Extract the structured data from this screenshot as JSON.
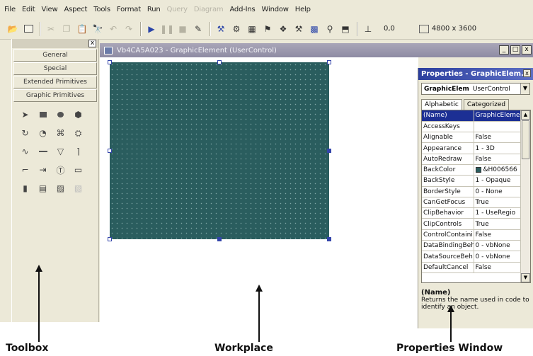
{
  "menu": [
    "File",
    "Edit",
    "View",
    "Aspect",
    "Tools",
    "Format",
    "Run",
    "Query",
    "Diagram",
    "Add-Ins",
    "Window",
    "Help"
  ],
  "menu_disabled": [
    "Query",
    "Diagram"
  ],
  "toolbar": {
    "coords": "0,0",
    "size": "4800 x 3600"
  },
  "toolbox": {
    "close_label": "x",
    "tabs": [
      "General",
      "Special",
      "Extended Primitives",
      "Graphic Primitives"
    ]
  },
  "document": {
    "title": "Vb4CA5A023 - GraphicElement (UserControl)",
    "controls": [
      "_",
      "□",
      "x"
    ],
    "canvas_color": "#2a5d5e"
  },
  "properties": {
    "title": "Properties - GraphicElem...",
    "close_label": "x",
    "object_name": "GraphicElem",
    "object_type": "UserControl",
    "tabs": [
      "Alphabetic",
      "Categorized"
    ],
    "rows": [
      {
        "name": "(Name)",
        "value": "GraphicEleme"
      },
      {
        "name": "AccessKeys",
        "value": ""
      },
      {
        "name": "Alignable",
        "value": "False"
      },
      {
        "name": "Appearance",
        "value": "1 - 3D"
      },
      {
        "name": "AutoRedraw",
        "value": "False"
      },
      {
        "name": "BackColor",
        "value": "&H006566"
      },
      {
        "name": "BackStyle",
        "value": "1 - Opaque"
      },
      {
        "name": "BorderStyle",
        "value": "0 - None"
      },
      {
        "name": "CanGetFocus",
        "value": "True"
      },
      {
        "name": "ClipBehavior",
        "value": "1 - UseRegio"
      },
      {
        "name": "ClipControls",
        "value": "True"
      },
      {
        "name": "ControlContaini",
        "value": "False"
      },
      {
        "name": "DataBindingBeh",
        "value": "0 - vbNone"
      },
      {
        "name": "DataSourceBeh",
        "value": "0 - vbNone"
      },
      {
        "name": "DefaultCancel",
        "value": "False"
      }
    ],
    "description_title": "(Name)",
    "description_text": "Returns the name used in code to identify an object."
  },
  "captions": {
    "toolbox": "Toolbox",
    "workplace": "Workplace",
    "properties": "Properties Window"
  }
}
